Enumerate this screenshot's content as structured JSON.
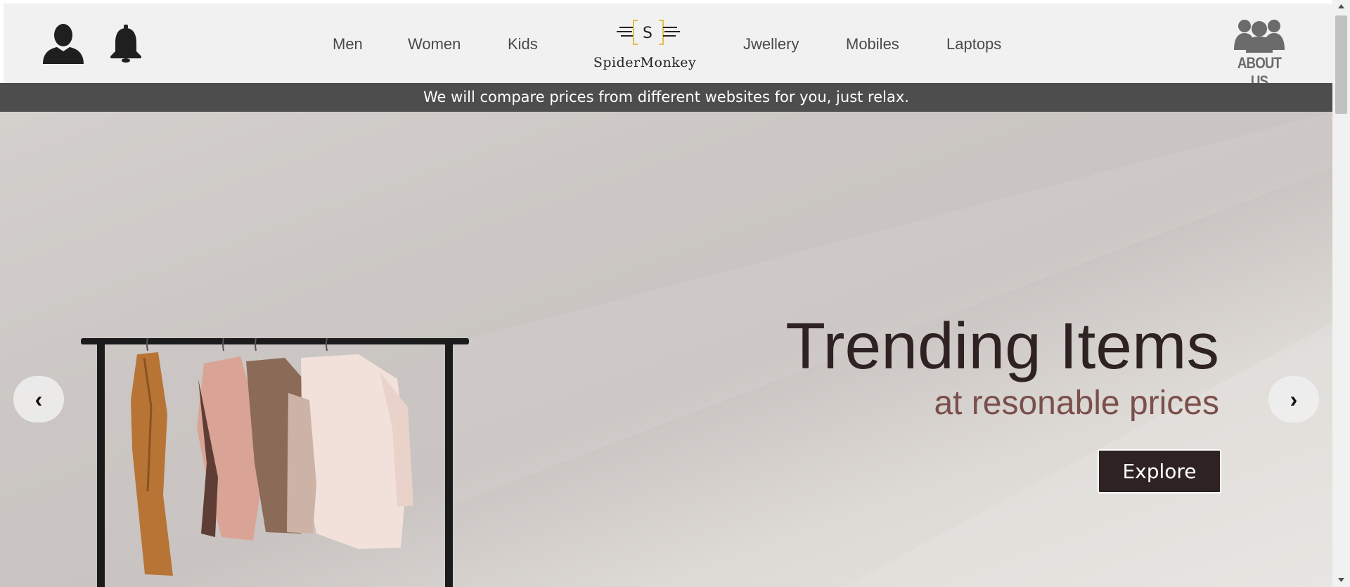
{
  "header": {
    "nav_left": [
      "Men",
      "Women",
      "Kids"
    ],
    "nav_right": [
      "Jwellery",
      "Mobiles",
      "Laptops"
    ],
    "logo": {
      "letter": "S",
      "name": "SpiderMonkey"
    },
    "about_label": "ABOUT US"
  },
  "banner": {
    "text": "We will compare prices from different websites for you, just relax."
  },
  "hero": {
    "title": "Trending Items",
    "subtitle": "at resonable prices",
    "button": "Explore",
    "prev_arrow": "‹",
    "next_arrow": "›"
  },
  "icons": {
    "user": "user-icon",
    "bell": "bell-icon",
    "about": "about-us-icon",
    "prev": "chevron-left-icon",
    "next": "chevron-right-icon"
  },
  "colors": {
    "header_bg": "#f1f1f1",
    "banner_bg": "#4d4d4d",
    "title": "#2e2322",
    "subtitle": "#7a4f4c",
    "button_bg": "#2e2322"
  }
}
